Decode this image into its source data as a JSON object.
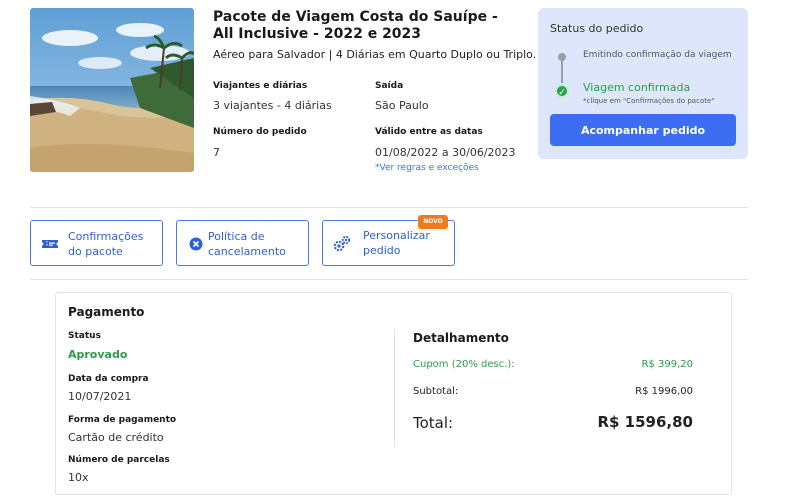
{
  "package": {
    "title": "Pacote de Viagem Costa do Sauípe - All Inclusive - 2022 e 2023",
    "subtitle": "Aéreo para Salvador | 4 Diárias em Quarto Duplo ou Triplo.",
    "travelers_label": "Viajantes e diárias",
    "travelers_value": "3 viajantes - 4 diárias",
    "departure_label": "Saída",
    "departure_value": "São Paulo",
    "order_label": "Número do pedido",
    "order_value": "7",
    "valid_label": "Válido entre as datas",
    "valid_value": "01/08/2022 a 30/06/2023",
    "rules_link": "*Ver regras e exceções"
  },
  "status": {
    "title": "Status do pedido",
    "step1": "Emitindo confirmação da viagem",
    "step2": "Viagem confirmada",
    "step2_hint": "*clique em \"Confirmações do pacote\"",
    "track_button": "Acompanhar pedido"
  },
  "actions": {
    "confirmations": [
      "Confirmações",
      "do pacote"
    ],
    "cancellation": [
      "Política de",
      "cancelamento"
    ],
    "customize": [
      "Personalizar",
      "pedido"
    ],
    "new_badge": "NOVO"
  },
  "payment": {
    "title": "Pagamento",
    "status_label": "Status",
    "status_value": "Aprovado",
    "date_label": "Data da compra",
    "date_value": "10/07/2021",
    "method_label": "Forma de pagamento",
    "method_value": "Cartão de crédito",
    "installments_label": "Número de parcelas",
    "installments_value": "10x"
  },
  "details": {
    "title": "Detalhamento",
    "coupon_label": "Cupom (20% desc.):",
    "coupon_value": "R$ 399,20",
    "subtotal_label": "Subtotal:",
    "subtotal_value": "R$ 1996,00",
    "total_label": "Total:",
    "total_value": "R$ 1596,80"
  },
  "colors": {
    "primary": "#3d6ef2",
    "success": "#2a9d48",
    "badge": "#f07b1f",
    "status_bg": "#dde6fa"
  }
}
